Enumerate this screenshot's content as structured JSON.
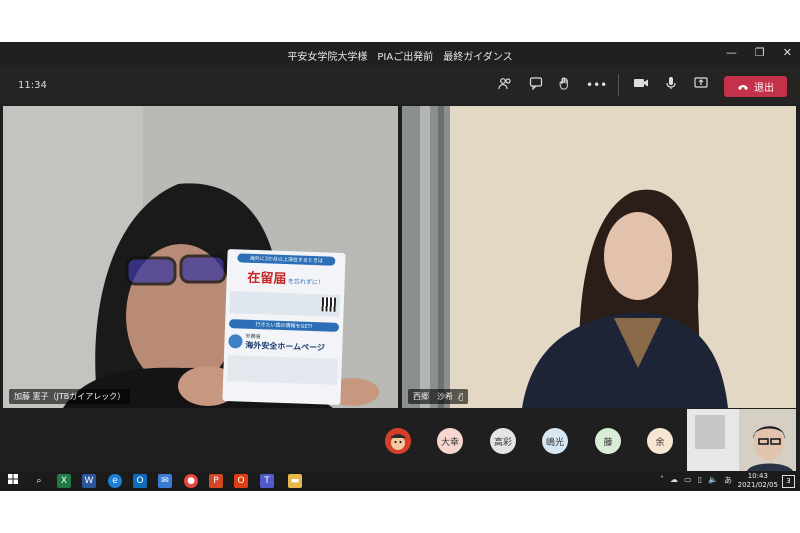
{
  "window": {
    "title": "平安女学院大学様　PIAご出発前　最終ガイダンス"
  },
  "toolbar": {
    "elapsed_time": "11:34",
    "leave_label": "退出"
  },
  "participants": {
    "left": {
      "name": "加藤 憲子（JTBガイアレック）"
    },
    "right": {
      "name": "西郷　沙希"
    }
  },
  "card": {
    "top_note": "海外に3か月以上滞在するときは",
    "title": "在留届",
    "title_suffix": "を忘れずに！",
    "section_note": "行きたい国の情報をGET!",
    "subtitle_small": "外務省",
    "subtitle": "海外安全ホームページ"
  },
  "roster": [
    {
      "label": "大幸",
      "color": "#f6d6cf"
    },
    {
      "label": "高彩",
      "color": "#e4e4e4"
    },
    {
      "label": "嶋光",
      "color": "#d6e6f2"
    },
    {
      "label": "藤",
      "color": "#d9ecd7"
    },
    {
      "label": "余",
      "color": "#f6e6d2"
    }
  ],
  "taskbar": {
    "time": "10:43",
    "date": "2021/02/05",
    "ime": "あ",
    "notifications": "3"
  },
  "colors": {
    "leave": "#c4314b",
    "toolbar": "#252423",
    "stage": "#1f1f1f"
  }
}
